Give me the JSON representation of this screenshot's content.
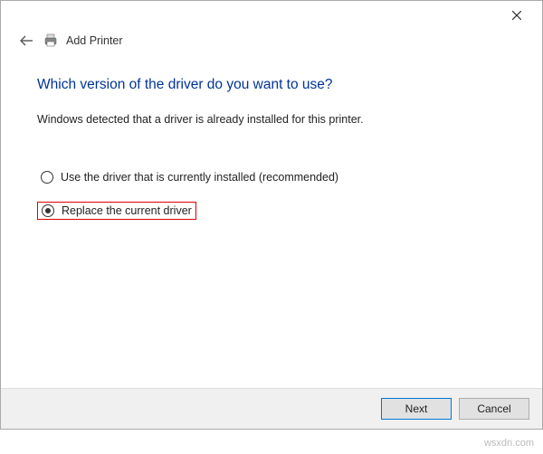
{
  "header": {
    "title": "Add Printer"
  },
  "main": {
    "heading": "Which version of the driver do you want to use?",
    "subtext": "Windows detected that a driver is already installed for this printer.",
    "options": {
      "use_existing": "Use the driver that is currently installed (recommended)",
      "replace": "Replace the current driver"
    }
  },
  "footer": {
    "next": "Next",
    "cancel": "Cancel"
  },
  "watermark": "wsxdn.com"
}
